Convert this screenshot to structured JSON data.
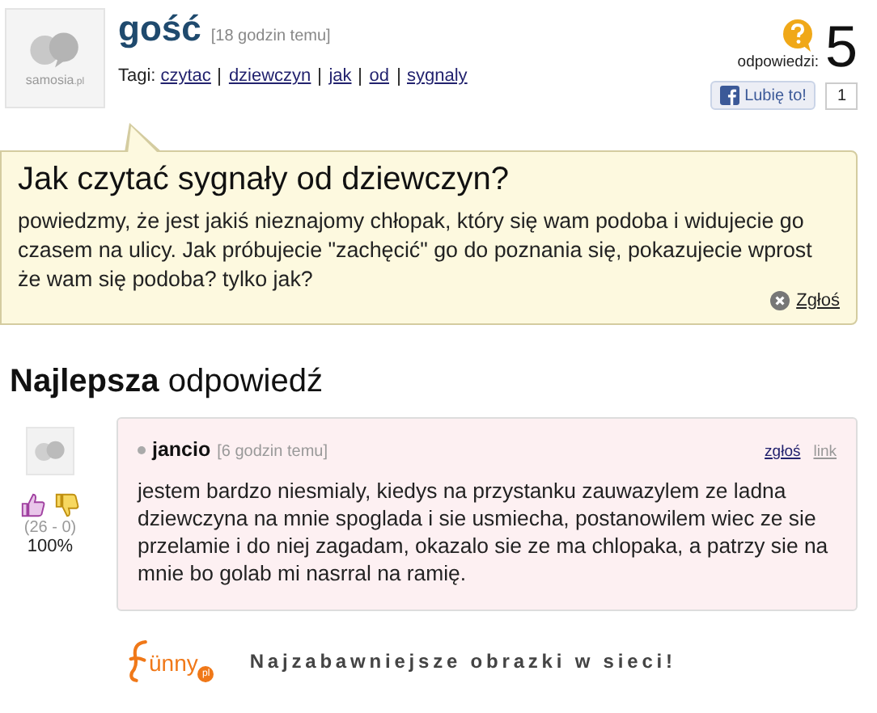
{
  "question": {
    "author": "gość",
    "time": "[18 godzin temu]",
    "tags_label": "Tagi:",
    "tags": [
      "czytac",
      "dziewczyn",
      "jak",
      "od",
      "sygnaly"
    ],
    "answers_label": "odpowiedzi:",
    "answers_count": "5",
    "like_label": "Lubię to!",
    "like_count": "1",
    "avatar_label": "samosia",
    "avatar_suffix": ".pl",
    "title": "Jak czytać sygnały od dziewczyn?",
    "body": "powiedzmy, że jest jakiś nieznajomy chłopak, który się wam podoba i widujecie go czasem na ulicy. Jak próbujecie \"zachęcić\" go do poznania się, pokazujecie wprost że wam się podoba? tylko jak?",
    "report": "Zgłoś"
  },
  "best_heading": "**Najlepsza** odpowiedź",
  "answer": {
    "author": "jancio",
    "time": "[6 godzin temu]",
    "report": "zgłoś",
    "link": "link",
    "votes": "(26 - 0)",
    "percent": "100%",
    "body": "jestem bardzo niesmialy, kiedys na przystanku zauwazylem ze ladna dziewczyna na mnie spoglada i sie usmiecha, postanowilem wiec ze sie przelamie i do niej zagadam, okazalo sie ze ma chlopaka, a patrzy sie na mnie bo golab mi nasrral na ramię."
  },
  "footer": {
    "logo": "ünny",
    "logo_badge": "pl",
    "tagline": "Najzabawniejsze obrazki w sieci!"
  }
}
